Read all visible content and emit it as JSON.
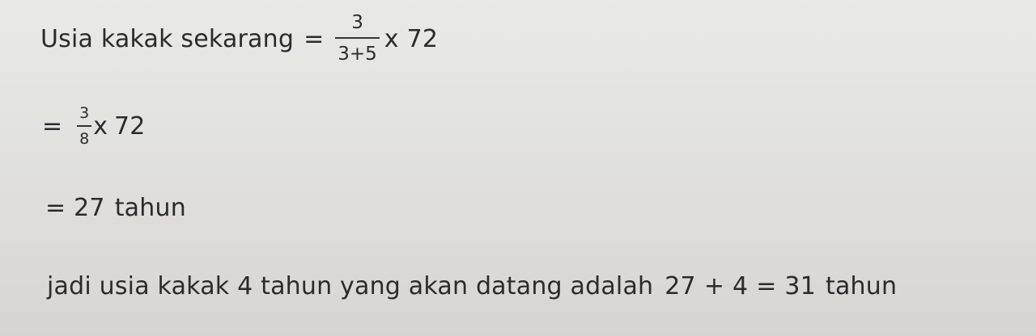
{
  "line1": {
    "label": "Usia kakak sekarang",
    "eq": "=",
    "frac_num": "3",
    "frac_den": "3+5",
    "times": "x",
    "factor": "72"
  },
  "line2": {
    "eq": "=",
    "frac_num": "3",
    "frac_den": "8",
    "times": "x",
    "factor": "72"
  },
  "line3": {
    "eq": "=",
    "value": "27",
    "unit": "tahun"
  },
  "line4": {
    "text": "jadi usia kakak 4 tahun yang akan datang adalah",
    "a": "27",
    "plus": "+",
    "b": "4",
    "eq": "=",
    "result": "31",
    "unit": "tahun"
  }
}
